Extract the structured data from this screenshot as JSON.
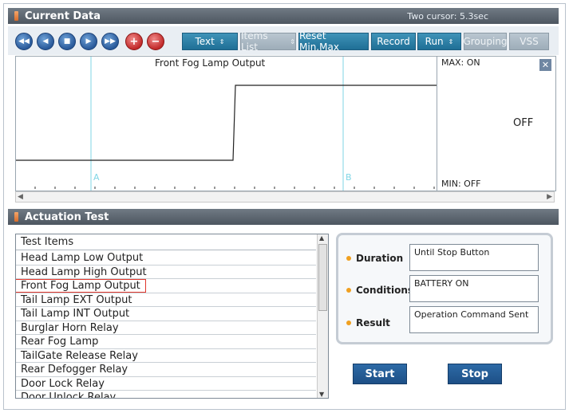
{
  "current_data": {
    "title": "Current Data",
    "cursor_info": "Two cursor: 5.3sec"
  },
  "toolbar": {
    "media_buttons": [
      "rewind",
      "back",
      "stop",
      "play",
      "fast-forward",
      "add",
      "remove"
    ],
    "text_label": "Text",
    "items_list_label": "Items List",
    "reset_label": "Reset Min.Max",
    "record_label": "Record",
    "run_label": "Run",
    "grouping_label": "Grouping",
    "vss_label": "VSS"
  },
  "chart": {
    "title": "Front Fog Lamp Output",
    "cursor_a": "A",
    "cursor_b": "B",
    "max_label": "MAX: ON",
    "min_label": "MIN: OFF",
    "current_value": "OFF",
    "close_glyph": "✕"
  },
  "chart_data": {
    "type": "line",
    "series": [
      {
        "name": "Front Fog Lamp Output",
        "values": [
          "OFF",
          "OFF",
          "ON",
          "ON"
        ]
      }
    ]
  },
  "actuation": {
    "title": "Actuation Test",
    "list_header": "Test Items",
    "items": [
      "Head Lamp Low Output",
      "Head Lamp High Output",
      "Front Fog Lamp Output",
      "Tail Lamp EXT Output",
      "Tail Lamp INT Output",
      "Burglar Horn Relay",
      "Rear Fog Lamp",
      "TailGate Release Relay",
      "Rear Defogger Relay",
      "Door Lock Relay",
      "Door Unlock Relay"
    ],
    "selected_index": 2,
    "duration_label": "Duration",
    "duration_value": "Until Stop Button",
    "conditions_label": "Conditions",
    "conditions_value": "BATTERY ON",
    "result_label": "Result",
    "result_value": "Operation Command Sent",
    "start_label": "Start",
    "stop_label": "Stop"
  }
}
